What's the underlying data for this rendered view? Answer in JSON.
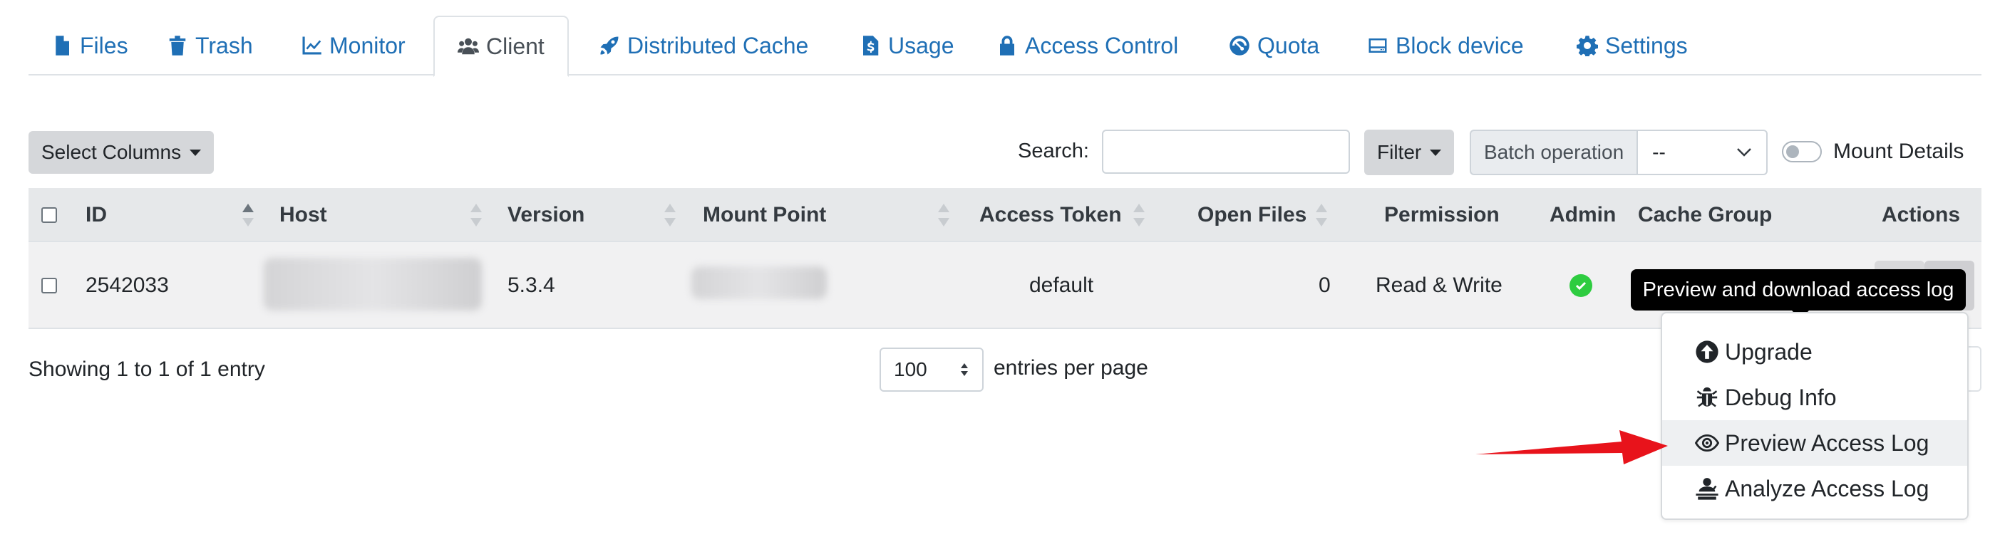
{
  "tabs": [
    {
      "label": "Files",
      "icon": "file-icon"
    },
    {
      "label": "Trash",
      "icon": "trash-icon"
    },
    {
      "label": "Monitor",
      "icon": "line-chart-icon"
    },
    {
      "label": "Client",
      "icon": "users-icon",
      "active": true
    },
    {
      "label": "Distributed Cache",
      "icon": "rocket-icon"
    },
    {
      "label": "Usage",
      "icon": "file-invoice-dollar-icon"
    },
    {
      "label": "Access Control",
      "icon": "lock-icon"
    },
    {
      "label": "Quota",
      "icon": "tachometer-icon"
    },
    {
      "label": "Block device",
      "icon": "hdd-icon"
    },
    {
      "label": "Settings",
      "icon": "gear-icon"
    }
  ],
  "toolbar": {
    "select_columns_label": "Select Columns",
    "search_label": "Search:",
    "search_value": "",
    "filter_label": "Filter",
    "batch_label": "Batch operation",
    "batch_value": "--",
    "mount_details_label": "Mount Details",
    "mount_details_on": false
  },
  "table": {
    "columns": [
      "ID",
      "Host",
      "Version",
      "Mount Point",
      "Access Token",
      "Open Files",
      "Permission",
      "Admin",
      "Cache Group",
      "Actions"
    ],
    "rows": [
      {
        "id": "2542033",
        "host": "",
        "version": "5.3.4",
        "mount_point": "",
        "access_token": "default",
        "open_files": "0",
        "permission": "Read & Write",
        "admin": true,
        "cache_group": ""
      }
    ]
  },
  "footer": {
    "showing": "Showing 1 to 1 of 1 entry",
    "per_page_value": "100",
    "per_page_label": "entries per page"
  },
  "tooltip": "Preview and download access log",
  "actions_menu": [
    {
      "label": "Upgrade",
      "icon": "arrow-circle-up-icon"
    },
    {
      "label": "Debug Info",
      "icon": "bug-icon"
    },
    {
      "label": "Preview Access Log",
      "icon": "eye-icon",
      "highlighted": true
    },
    {
      "label": "Analyze Access Log",
      "icon": "user-analyze-icon"
    }
  ],
  "colors": {
    "link": "#1f6fb5",
    "header_bg": "#e6e8ea",
    "row_bg": "#f1f1f2",
    "admin_ok": "#2ecc40",
    "arrow": "#e8131b",
    "tooltip_bg": "#000000"
  }
}
